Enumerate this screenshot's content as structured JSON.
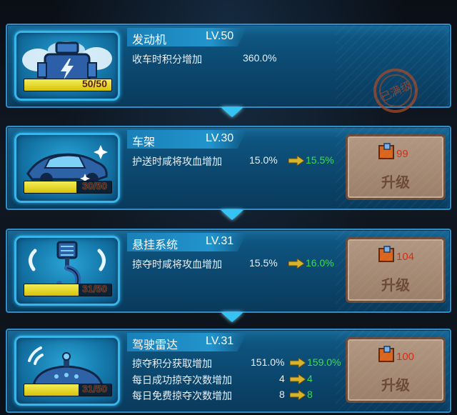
{
  "items": [
    {
      "name": "发动机",
      "level": "LV.50",
      "progress": "50/50",
      "progress_fraction": 1.0,
      "stats": [
        {
          "label": "收车时积分增加",
          "current": "360.0%",
          "next": ""
        }
      ],
      "maxed_stamp": "已满级",
      "icon": "engine-icon"
    },
    {
      "name": "车架",
      "level": "LV.30",
      "progress": "30/50",
      "progress_fraction": 0.6,
      "stats": [
        {
          "label": "护送时咸将攻血增加",
          "current": "15.0%",
          "next": "15.5%"
        }
      ],
      "cost": "99",
      "upgrade_label": "升级",
      "icon": "car-frame-icon"
    },
    {
      "name": "悬挂系统",
      "level": "LV.31",
      "progress": "31/50",
      "progress_fraction": 0.62,
      "stats": [
        {
          "label": "掠夺时咸将攻血增加",
          "current": "15.5%",
          "next": "16.0%"
        }
      ],
      "cost": "104",
      "upgrade_label": "升级",
      "icon": "suspension-hook-icon"
    },
    {
      "name": "驾驶雷达",
      "level": "LV.31",
      "progress": "31/50",
      "progress_fraction": 0.62,
      "stats": [
        {
          "label": "掠夺积分获取增加",
          "current": "151.0%",
          "next": "159.0%"
        },
        {
          "label": "每日成功掠夺次数增加",
          "current": "4",
          "next": "4"
        },
        {
          "label": "每日免费掠夺次数增加",
          "current": "8",
          "next": "8"
        }
      ],
      "cost": "100",
      "upgrade_label": "升级",
      "icon": "radar-icon"
    }
  ],
  "colors": {
    "panel": "#0f5a86",
    "frame": "#36b6ea",
    "progress_fill": "#e6d62a",
    "next_value": "#37e04a",
    "cost": "#d62b15",
    "upgrade_box": "#a88d78"
  }
}
